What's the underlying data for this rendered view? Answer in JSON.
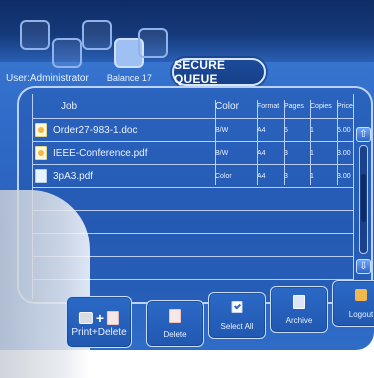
{
  "header": {
    "title": "SECURE QUEUE",
    "user_label": "User:Administrator",
    "balance_label": "Balance 17"
  },
  "table": {
    "columns": {
      "job": "Job",
      "color": "Color",
      "format": "Format",
      "pages": "Pages",
      "copies": "Copies",
      "price": "Price"
    },
    "rows": [
      {
        "job": "Order27-983-1.doc",
        "color": "B/W",
        "format": "A4",
        "pages": "5",
        "copies": "1",
        "price": "5.00",
        "icon": "doc-icon"
      },
      {
        "job": "IEEE-Conference.pdf",
        "color": "B/W",
        "format": "A4",
        "pages": "3",
        "copies": "1",
        "price": "3.00",
        "icon": "doc-icon"
      },
      {
        "job": "3pA3.pdf",
        "color": "Color",
        "format": "A4",
        "pages": "3",
        "copies": "1",
        "price": "3.00",
        "icon": "pdf-icon"
      }
    ]
  },
  "toolbar": {
    "print_delete": "Print+Delete",
    "delete": "Delete",
    "select_all": "Select All",
    "archive": "Archive",
    "logout": "Logout"
  },
  "scrollbar": {
    "up": "⇧",
    "down": "⇩"
  }
}
